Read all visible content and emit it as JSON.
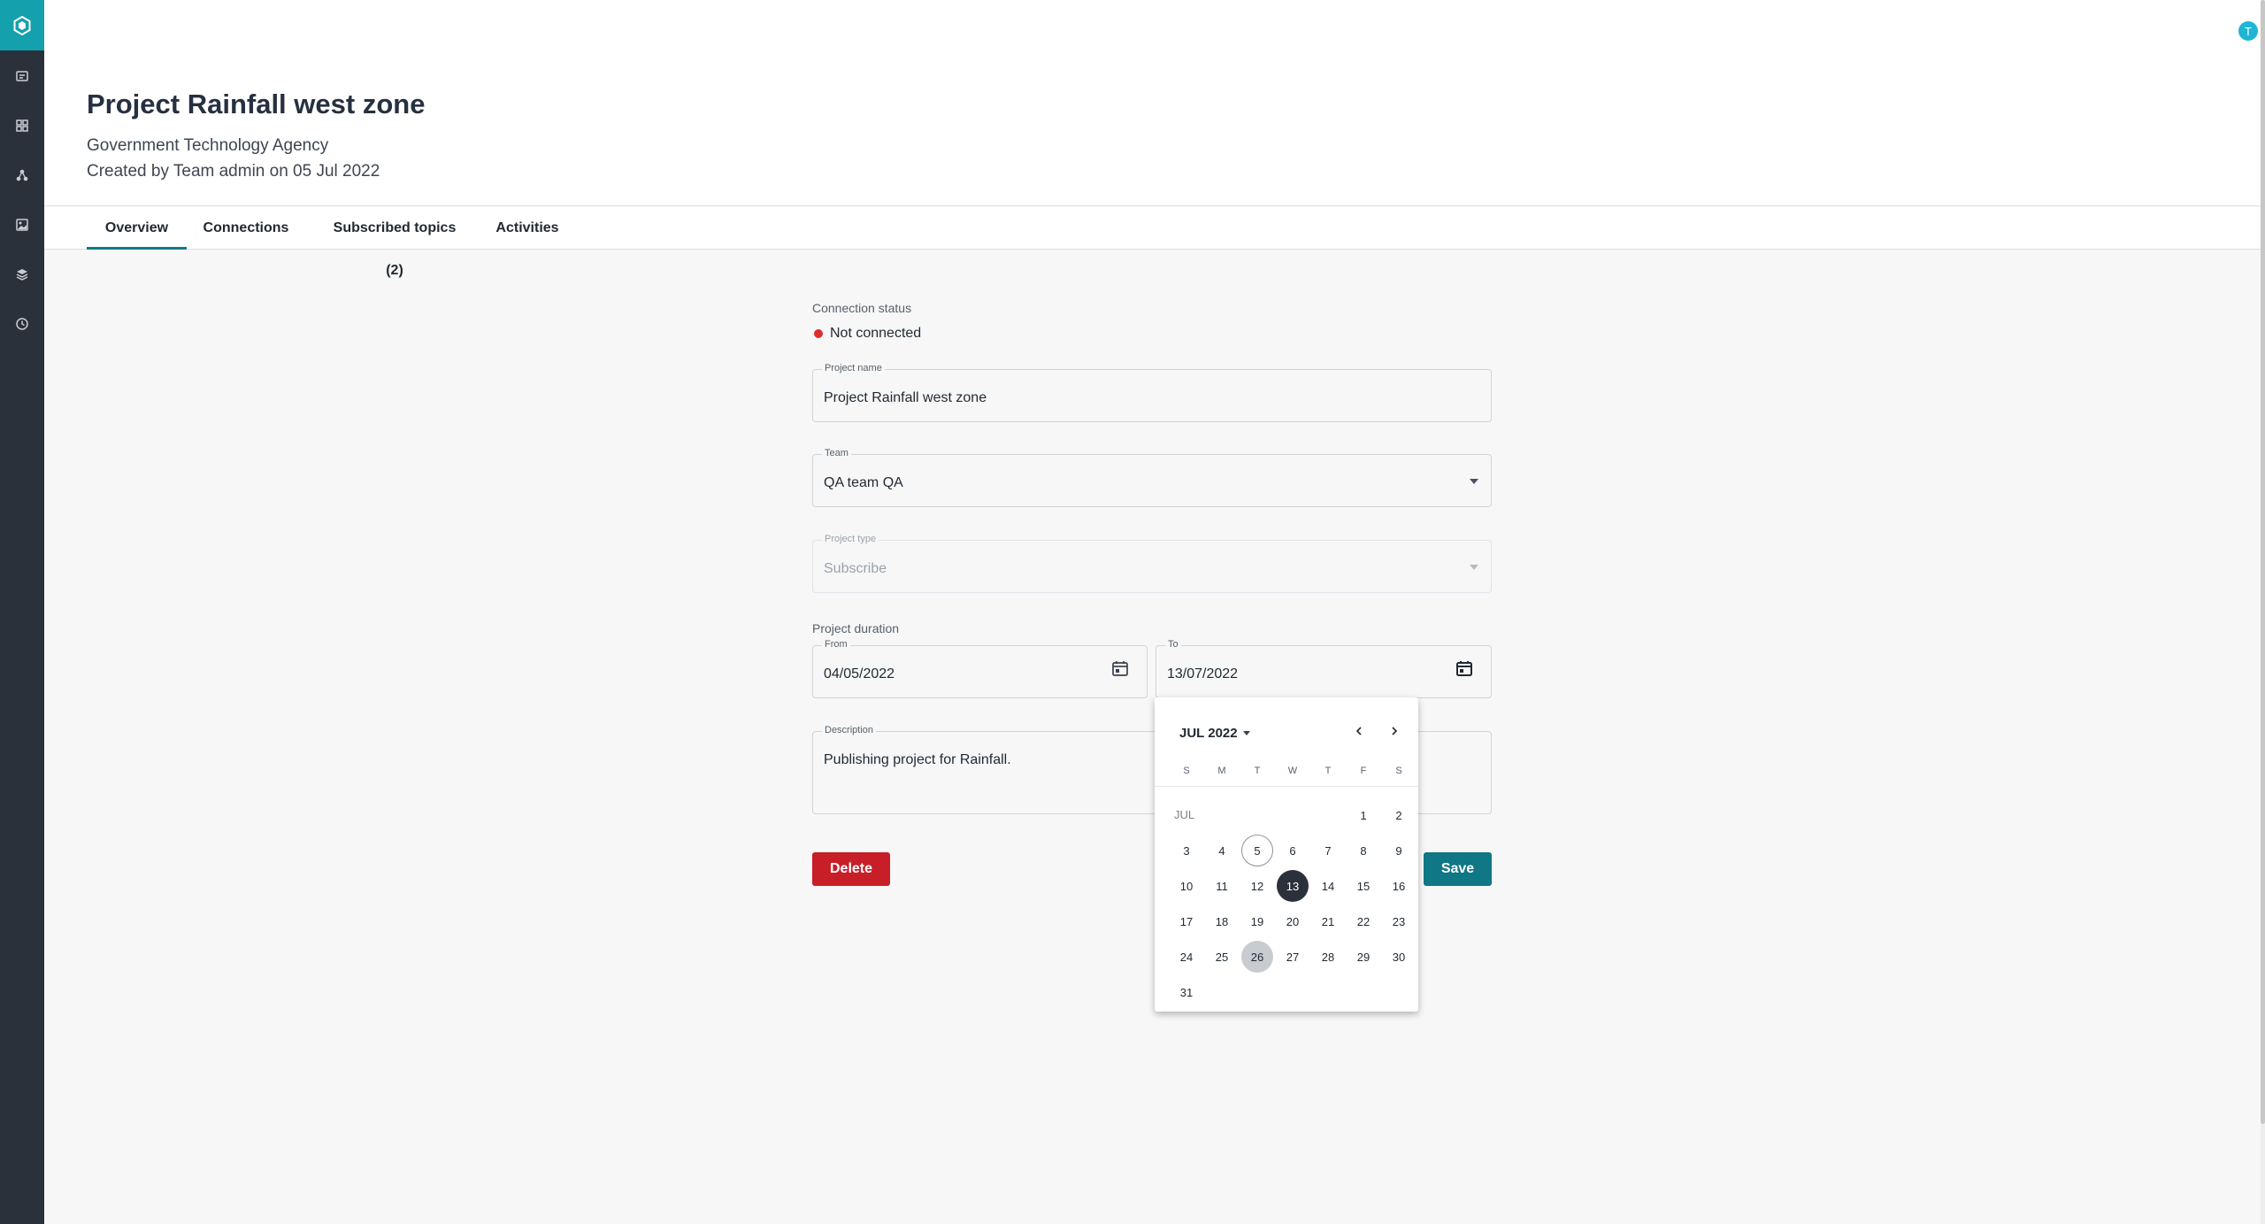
{
  "sidebar": {
    "items": [
      {
        "icon": "catalog-icon"
      },
      {
        "icon": "grid-icon"
      },
      {
        "icon": "network-icon"
      },
      {
        "icon": "image-icon"
      },
      {
        "icon": "stack-icon"
      },
      {
        "icon": "clock-icon"
      }
    ]
  },
  "header": {
    "title": "Project Rainfall west zone",
    "agency": "Government Technology Agency",
    "created": "Created by Team admin on 05 Jul 2022",
    "avatar_initial": "T"
  },
  "tabs": [
    {
      "label": "Overview",
      "active": true
    },
    {
      "label": "Connections",
      "active": false
    },
    {
      "label": "Subscribed topics (2)",
      "active": false
    },
    {
      "label": "Activities",
      "active": false
    }
  ],
  "form": {
    "connection_status_label": "Connection status",
    "connection_status": "Not connected",
    "project_name": {
      "label": "Project name",
      "value": "Project Rainfall west zone"
    },
    "team": {
      "label": "Team",
      "value": "QA team QA"
    },
    "project_type": {
      "label": "Project type",
      "value": "Subscribe"
    },
    "duration_label": "Project duration",
    "from": {
      "label": "From",
      "value": "04/05/2022"
    },
    "to": {
      "label": "To",
      "value": "13/07/2022"
    },
    "description": {
      "label": "Description",
      "value": "Publishing project for Rainfall."
    },
    "delete_label": "Delete",
    "save_label": "Save"
  },
  "calendar": {
    "month_year": "JUL 2022",
    "month_short": "JUL",
    "weekdays": [
      "S",
      "M",
      "T",
      "W",
      "T",
      "F",
      "S"
    ],
    "today": 5,
    "selected": 13,
    "hovered": 26,
    "days_in_month": 31,
    "first_weekday": 5
  },
  "colors": {
    "sidebar": "#2b313a",
    "brand": "#14a0ad",
    "accent": "#0f7785",
    "danger": "#c81e28",
    "status_error": "#e02d2d"
  }
}
